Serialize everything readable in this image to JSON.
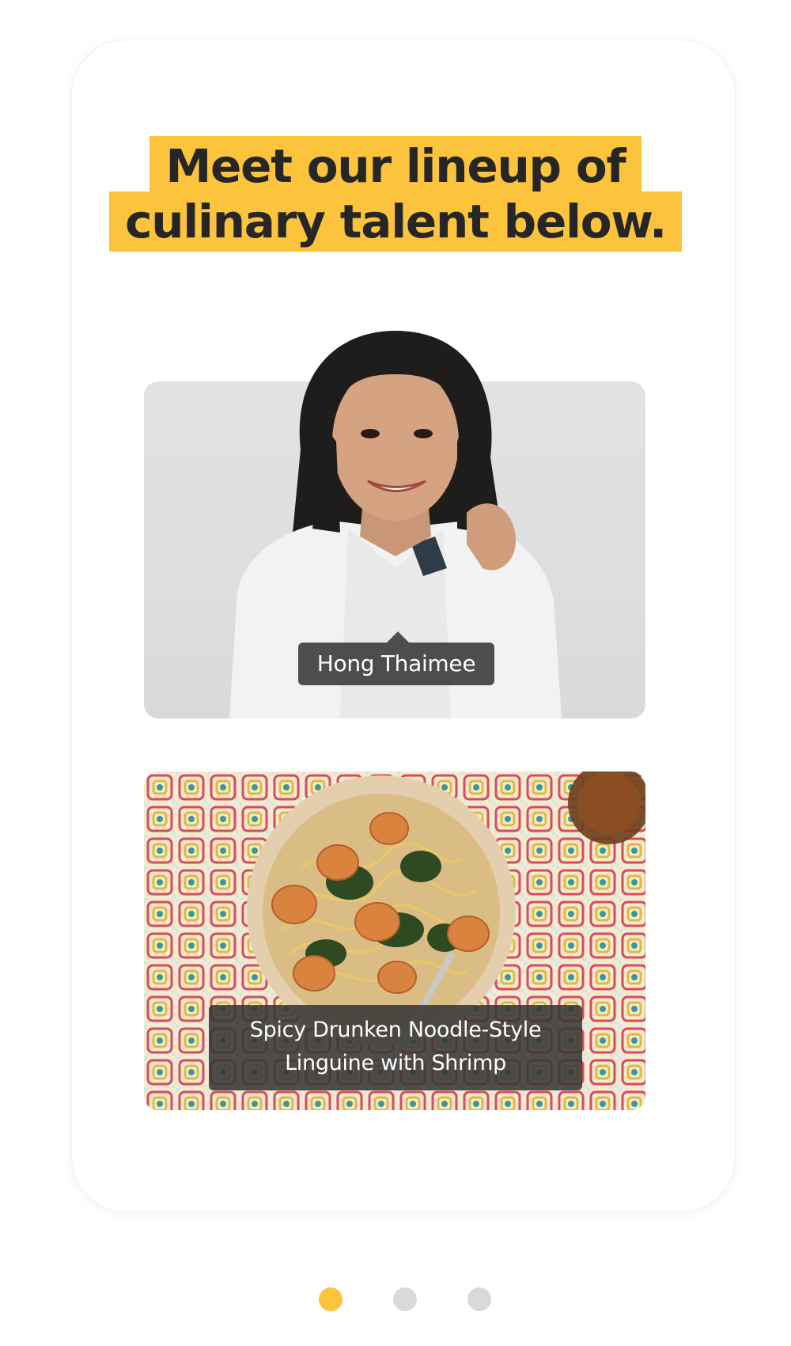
{
  "headline": {
    "line1": "Meet our lineup of",
    "line2": "culinary talent below.",
    "highlight_color": "#fcc33c"
  },
  "chef": {
    "name": "Hong Thaimee",
    "image": "chef-portrait"
  },
  "dish": {
    "line1": "Spicy Drunken Noodle-Style",
    "line2": "Linguine with Shrimp",
    "image": "shrimp-linguine-bowl"
  },
  "pagination": {
    "count": 3,
    "active_index": 0,
    "active_color": "#fcc33c",
    "inactive_color": "#d9d9d9"
  }
}
